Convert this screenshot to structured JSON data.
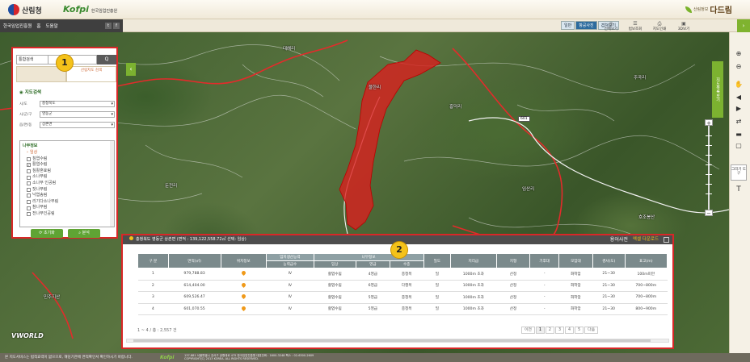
{
  "header": {
    "org_name": "산림청",
    "kofpi_logo": "Kofpi",
    "kofpi_name": "한국임업진흥원",
    "brand_small": "산림정보",
    "brand_big": "다드림",
    "nav_links": [
      "한국임업진흥원",
      "홈",
      "도움말"
    ],
    "social": [
      "t",
      "f"
    ],
    "map_modes": [
      "일반",
      "항공사진",
      "겹쳐보기"
    ],
    "active_map_mode": "겹쳐보기",
    "tools": [
      {
        "label": "전체보기",
        "icon": "globe-icon"
      },
      {
        "label": "범보조회",
        "icon": "list-icon"
      },
      {
        "label": "지도인쇄",
        "icon": "print-icon"
      },
      {
        "label": "3D보기",
        "icon": "cube-icon"
      }
    ]
  },
  "left_panel": {
    "search_select": "통합검색",
    "search_button": "Q",
    "tabs": [
      "",
      "산림지도 검색"
    ],
    "section_title": "지도검색",
    "fields": [
      {
        "label": "시/도",
        "value": "충청북도"
      },
      {
        "label": "시/군/구",
        "value": "영동군"
      },
      {
        "label": "읍/면/동",
        "value": "상촌면"
      }
    ],
    "tree_title": "나무정보",
    "tree_group": "임상",
    "tree_items": [
      {
        "label": "침엽수림",
        "checked": false
      },
      {
        "label": "활엽수림",
        "checked": true
      },
      {
        "label": "침활혼효림",
        "checked": false
      },
      {
        "label": "소나무림",
        "checked": false
      },
      {
        "label": "소나무 인공림",
        "checked": false
      },
      {
        "label": "잣나무림",
        "checked": false
      },
      {
        "label": "낙엽송림",
        "checked": false
      },
      {
        "label": "리기다소나무림",
        "checked": false
      },
      {
        "label": "참나무림",
        "checked": false
      },
      {
        "label": "전나무인공림",
        "checked": false
      }
    ],
    "reset_button": "초기화",
    "analyze_button": "분석"
  },
  "map": {
    "labels": [
      "대해리",
      "물한리",
      "흥덕리",
      "주곡리",
      "둔전리",
      "임산리",
      "호조봉산",
      "민주지산"
    ],
    "road_sign": "601",
    "side_tab": "지도목록보기",
    "draw_tool": "그리기 도구",
    "vworld": "VWORLD"
  },
  "result_panel": {
    "title": "충청북도 영동군 상촌면 (면적 : 139,122,558.72㎡ 선택: 임상)",
    "aerial_btn": "용어사전",
    "download_btn": "엑셀 다운로드",
    "group_headers": [
      "임지생산능력",
      "나무정보"
    ],
    "columns": [
      "구 분",
      "면적(㎡)",
      "위치정보",
      "능력급수",
      "임상",
      "영급",
      "수종",
      "밀도",
      "지리급",
      "지형",
      "기후대",
      "모암대",
      "경사(도)",
      "표고(m)"
    ],
    "rows": [
      [
        "1",
        "979,788.83",
        "IV",
        "활엽수림",
        "4영급",
        "충청목",
        "밀",
        "1000m 초과",
        "산정",
        "-",
        "화학암",
        "21~30",
        "100m미만"
      ],
      [
        "2",
        "614,404.00",
        "IV",
        "활엽수림",
        "6영급",
        "다행목",
        "밀",
        "1000m 초과",
        "산정",
        "-",
        "화학암",
        "21~30",
        "700~800m"
      ],
      [
        "3",
        "609,526.47",
        "IV",
        "활엽수림",
        "5영급",
        "충청목",
        "밀",
        "1000m 초과",
        "산정",
        "-",
        "화학암",
        "21~30",
        "700~800m"
      ],
      [
        "4",
        "601,070.55",
        "IV",
        "활엽수림",
        "5영급",
        "충청목",
        "밀",
        "1000m 초과",
        "산정",
        "-",
        "화학암",
        "21~30",
        "800~900m"
      ]
    ],
    "record_info": "1 ~ 4 / 총 : 2,557 건",
    "pager": [
      "이전",
      "1",
      "2",
      "3",
      "4",
      "5",
      "다음"
    ],
    "active_page": "1"
  },
  "callouts": [
    "1",
    "2"
  ],
  "footer": {
    "notice": "본 지도서비스는 법적효력이 없으므로, 해당기관에 면적확인서 확인하시기 바랍니다.",
    "logo": "Kofpi",
    "address": "137-881 서울특별시 강서구 공항대로 475 한국임업진흥원 대표전화 : 1600-3248 팩스 : 02-6300-2609",
    "copyright": "COPYRIGHT(C) 2013 KOREA. ALL RIGHTS RESERVED."
  },
  "colors": {
    "accent_green": "#7cb230",
    "highlight_red": "#d92727",
    "callout_yellow": "#f4c21a"
  }
}
